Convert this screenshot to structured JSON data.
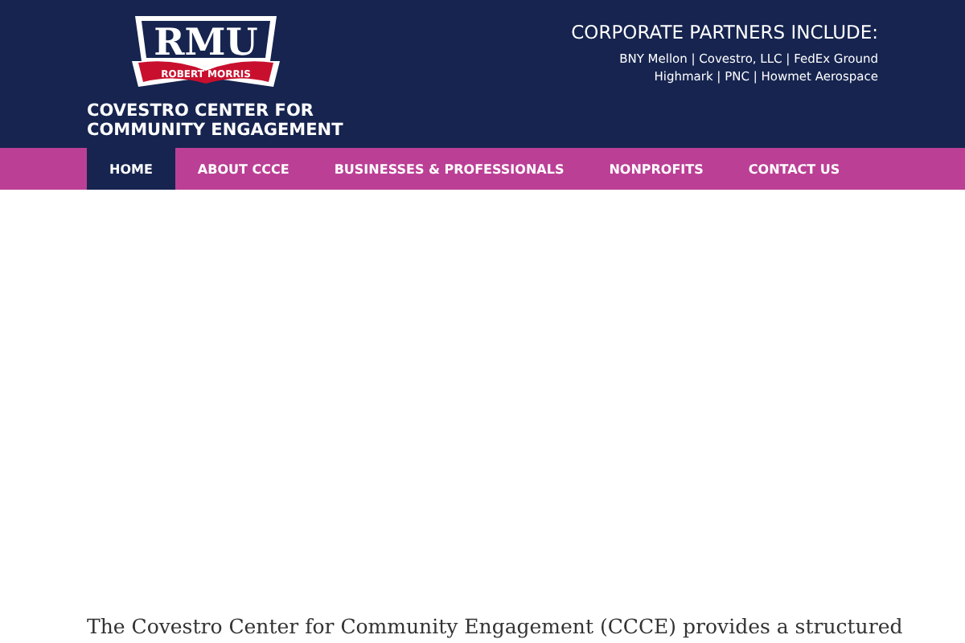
{
  "header": {
    "logo": {
      "monogram": "RMU",
      "banner": "ROBERT MORRIS"
    },
    "center_name": [
      "COVESTRO CENTER FOR",
      "COMMUNITY ENGAGEMENT"
    ],
    "partners": {
      "heading": "CORPORATE PARTNERS INCLUDE:",
      "lines": [
        "BNY Mellon | Covestro, LLC | FedEx Ground",
        "Highmark | PNC | Howmet Aerospace"
      ]
    }
  },
  "nav": [
    {
      "label": "HOME",
      "selected": true
    },
    {
      "label": "ABOUT CCCE",
      "selected": false
    },
    {
      "label": "BUSINESSES & PROFESSIONALS",
      "selected": false
    },
    {
      "label": "NONPROFITS",
      "selected": false
    },
    {
      "label": "CONTACT US",
      "selected": false
    }
  ],
  "intro": "The Covestro Center for Community Engagement (CCCE) provides a structured"
}
